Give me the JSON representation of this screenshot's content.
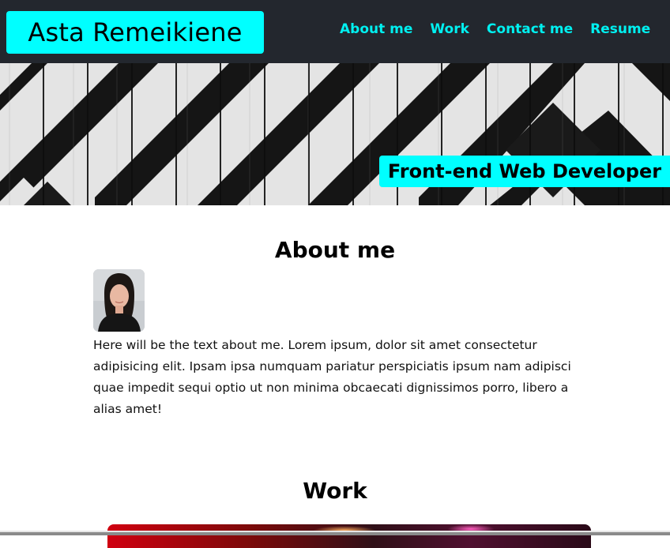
{
  "header": {
    "brand": "Asta Remeikiene",
    "nav": [
      {
        "label": "About me"
      },
      {
        "label": "Work"
      },
      {
        "label": "Contact me"
      },
      {
        "label": "Resume"
      }
    ]
  },
  "hero": {
    "tagline": "Front-end Web Developer"
  },
  "about": {
    "title": "About me",
    "text": "Here will be the text about me. Lorem ipsum, dolor sit amet consectetur adipisicing elit. Ipsam ipsa numquam pariatur perspiciatis ipsum nam adipisci quae impedit sequi optio ut non minima obcaecati dignissimos porro, libero a alias amet!"
  },
  "work": {
    "title": "Work"
  },
  "colors": {
    "header_bg": "#23272e",
    "accent": "#00ffff",
    "nav_link": "#00f0f0"
  }
}
